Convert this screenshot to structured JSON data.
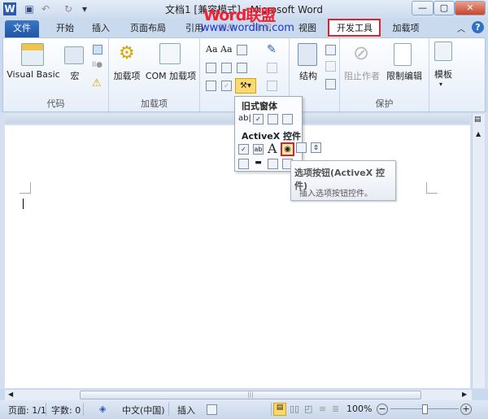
{
  "window": {
    "title": "文档1 [兼容模式] - Microsoft Word",
    "watermark": "Word联盟",
    "watermark_url": "www.wordlm.com"
  },
  "tabs": [
    "文件",
    "开始",
    "插入",
    "页面布局",
    "引用",
    "邮件",
    "审阅",
    "视图",
    "开发工具",
    "加载项"
  ],
  "ribbon": {
    "code": {
      "label": "代码",
      "visual_basic": "Visual Basic",
      "macro": "宏"
    },
    "addins": {
      "label": "加载项",
      "addin": "加载项",
      "com": "COM 加载项"
    },
    "mapping": {
      "structure": "结构"
    },
    "protect": {
      "label": "保护",
      "block": "阻止作者",
      "restrict": "限制编辑"
    },
    "templates": {
      "template": "模板"
    }
  },
  "dropdown": {
    "legacy": "旧式窗体",
    "activex": "ActiveX 控件"
  },
  "tooltip": {
    "title": "选项按钮(ActiveX 控件)",
    "desc": "插入选项按钮控件。"
  },
  "status": {
    "page": "页面: 1/1",
    "words": "字数: 0",
    "lang": "中文(中国)",
    "mode": "插入",
    "zoom": "100%",
    "zoom_level": 0.5
  },
  "colors": {
    "highlight": "#e0202a",
    "file_tab": "#2a62b0"
  }
}
